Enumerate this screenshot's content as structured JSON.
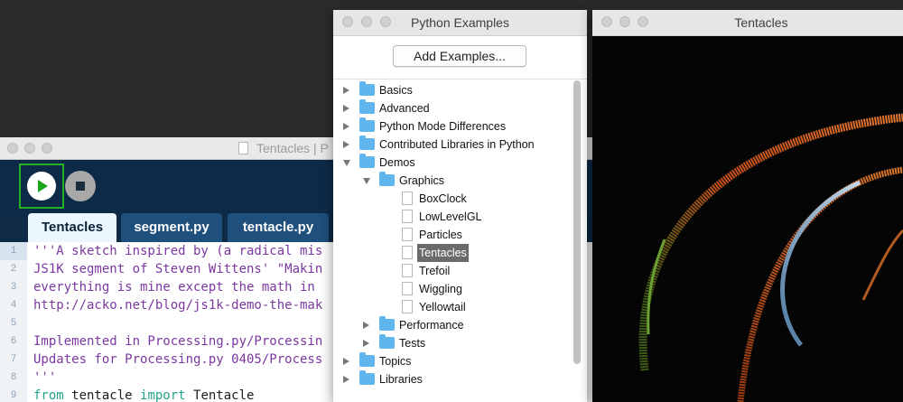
{
  "ide": {
    "title": "Tentacles | P",
    "tabs": [
      "Tentacles",
      "segment.py",
      "tentacle.py"
    ],
    "line_numbers": [
      "1",
      "2",
      "3",
      "4",
      "5",
      "6",
      "7",
      "8",
      "9"
    ],
    "code_lines": [
      "'''A sketch inspired by (a radical mis",
      "JS1K segment of Steven Wittens' \"Makin",
      "everything is mine except the math in",
      "http://acko.net/blog/js1k-demo-the-mak",
      "",
      "Implemented in Processing.py/Processin",
      "Updates for Processing.py 0405/Process",
      "'''"
    ],
    "import_line": {
      "kw1": "from",
      "mod": " tentacle ",
      "kw2": "import",
      "name": " Tentacle"
    }
  },
  "examples": {
    "title": "Python Examples",
    "add_button": "Add Examples...",
    "tree": {
      "basics": "Basics",
      "advanced": "Advanced",
      "mode_diff": "Python Mode Differences",
      "contrib": "Contributed Libraries in Python",
      "demos": "Demos",
      "graphics": "Graphics",
      "files": [
        "BoxClock",
        "LowLevelGL",
        "Particles",
        "Tentacles",
        "Trefoil",
        "Wiggling",
        "Yellowtail"
      ],
      "performance": "Performance",
      "tests": "Tests",
      "topics": "Topics",
      "libraries": "Libraries"
    },
    "selected": "Tentacles"
  },
  "sketch": {
    "title": "Tentacles"
  },
  "colors": {
    "ide_background": "#0e2a44",
    "run_highlight": "#22b21f",
    "folder": "#5fb6ec",
    "selection": "#6b6b6b",
    "comment_text": "#7a38a0",
    "keyword_text": "#22a08b"
  }
}
